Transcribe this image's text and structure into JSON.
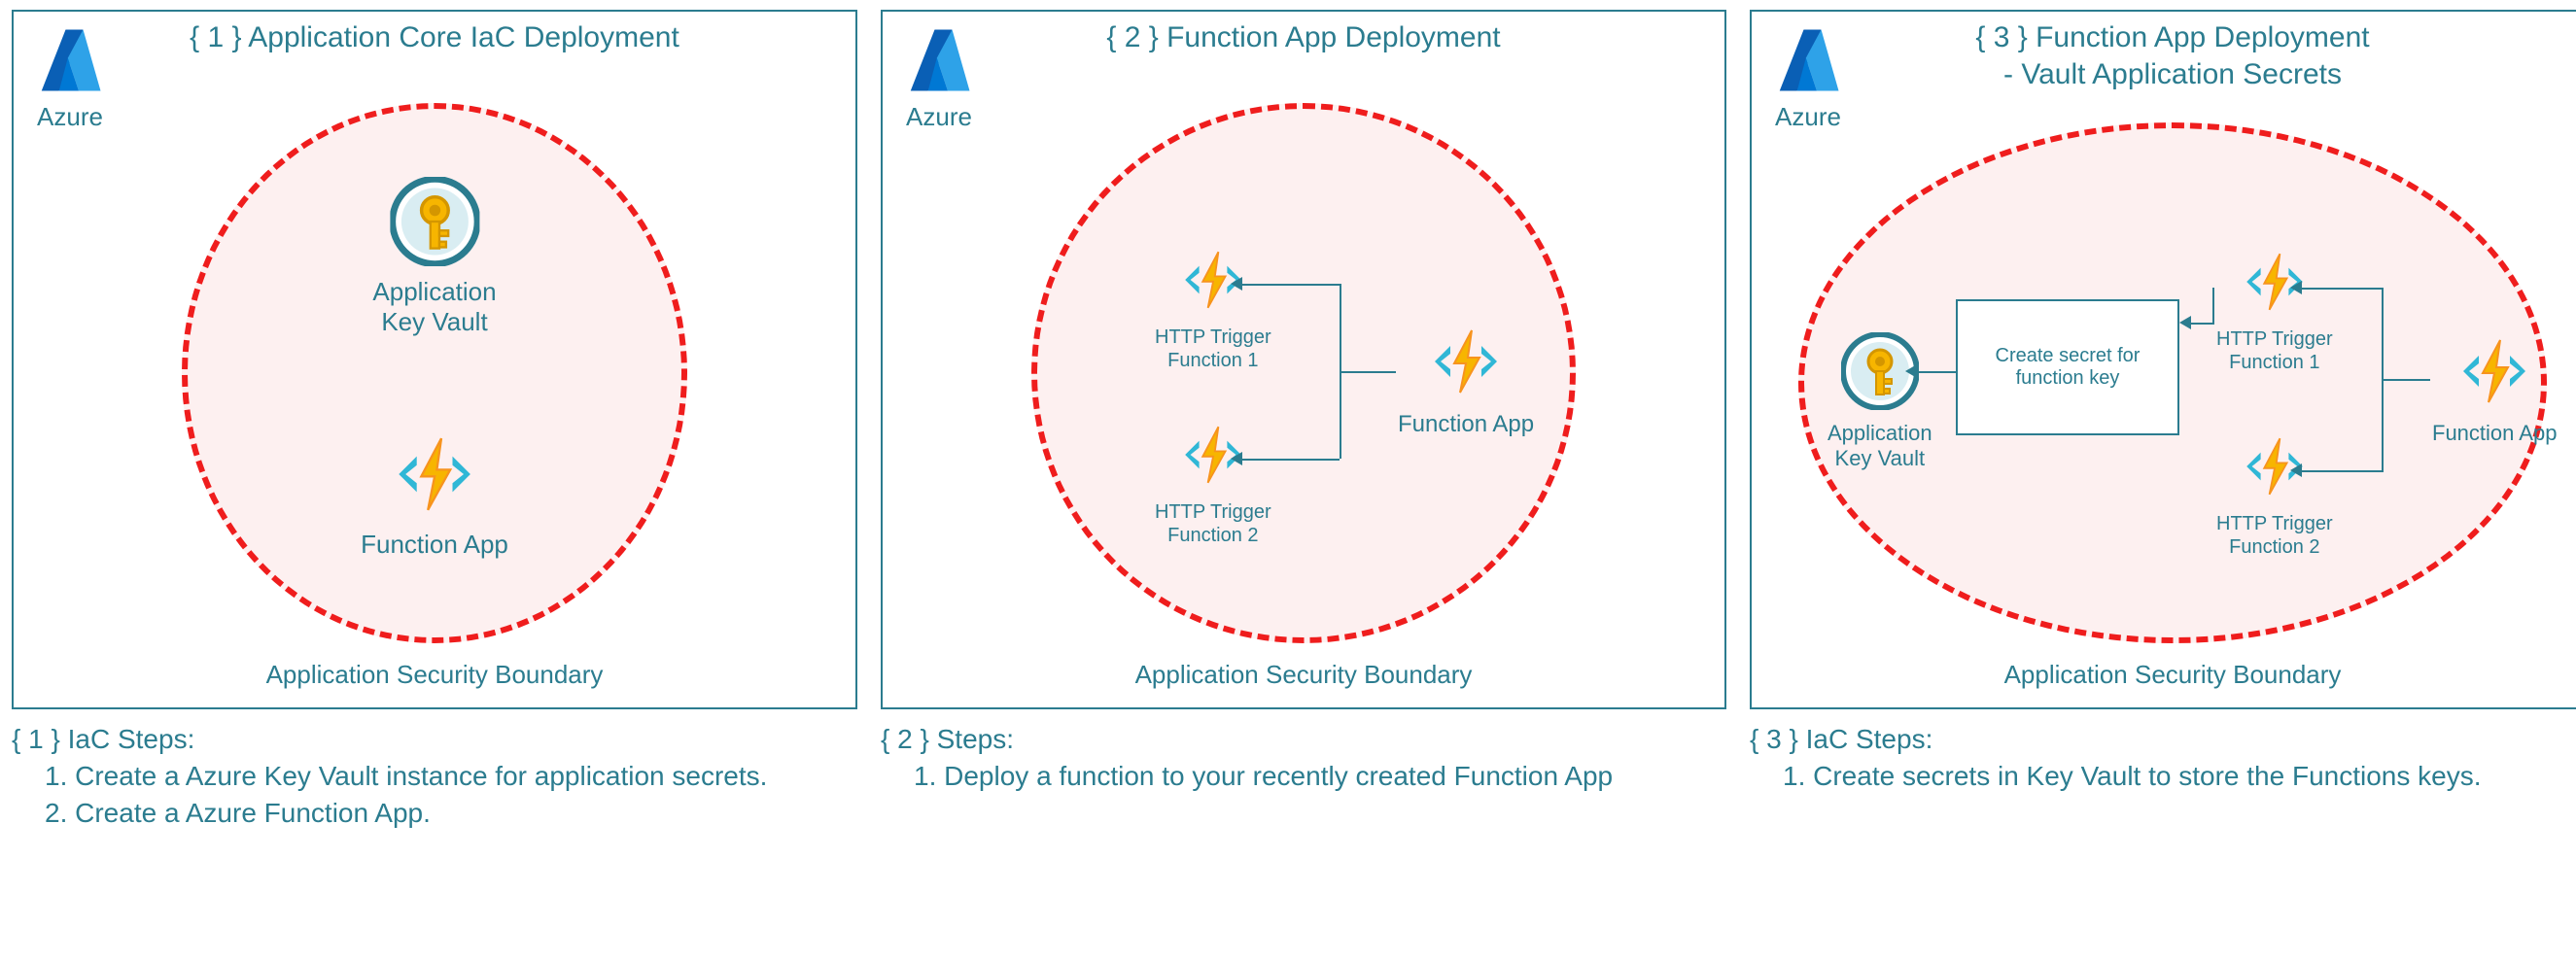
{
  "azure_label": "Azure",
  "boundary_label": "Application Security Boundary",
  "panels": {
    "p1": {
      "title": "{ 1 } Application Core IaC Deployment",
      "keyvault_label": "Application\nKey Vault",
      "funcapp_label": "Function App",
      "steps_header": "{ 1 } IaC Steps:",
      "step1": "1. Create a Azure Key Vault instance for application secrets.",
      "step2": "2. Create a Azure Function App."
    },
    "p2": {
      "title": "{ 2 } Function App Deployment",
      "funcapp_label": "Function App",
      "trigger1_label": "HTTP Trigger\nFunction 1",
      "trigger2_label": "HTTP Trigger\nFunction 2",
      "steps_header": "{ 2 } Steps:",
      "step1": "1. Deploy a function to your recently created Function App"
    },
    "p3": {
      "title": "{ 3 } Function App Deployment\n- Vault Application Secrets",
      "keyvault_label": "Application\nKey Vault",
      "funcapp_label": "Function App",
      "trigger1_label": "HTTP Trigger\nFunction 1",
      "trigger2_label": "HTTP Trigger\nFunction 2",
      "box_label": "Create secret for\nfunction key",
      "steps_header": "{ 3 } IaC Steps:",
      "step1": "1. Create secrets in Key Vault to store the Functions keys."
    }
  }
}
